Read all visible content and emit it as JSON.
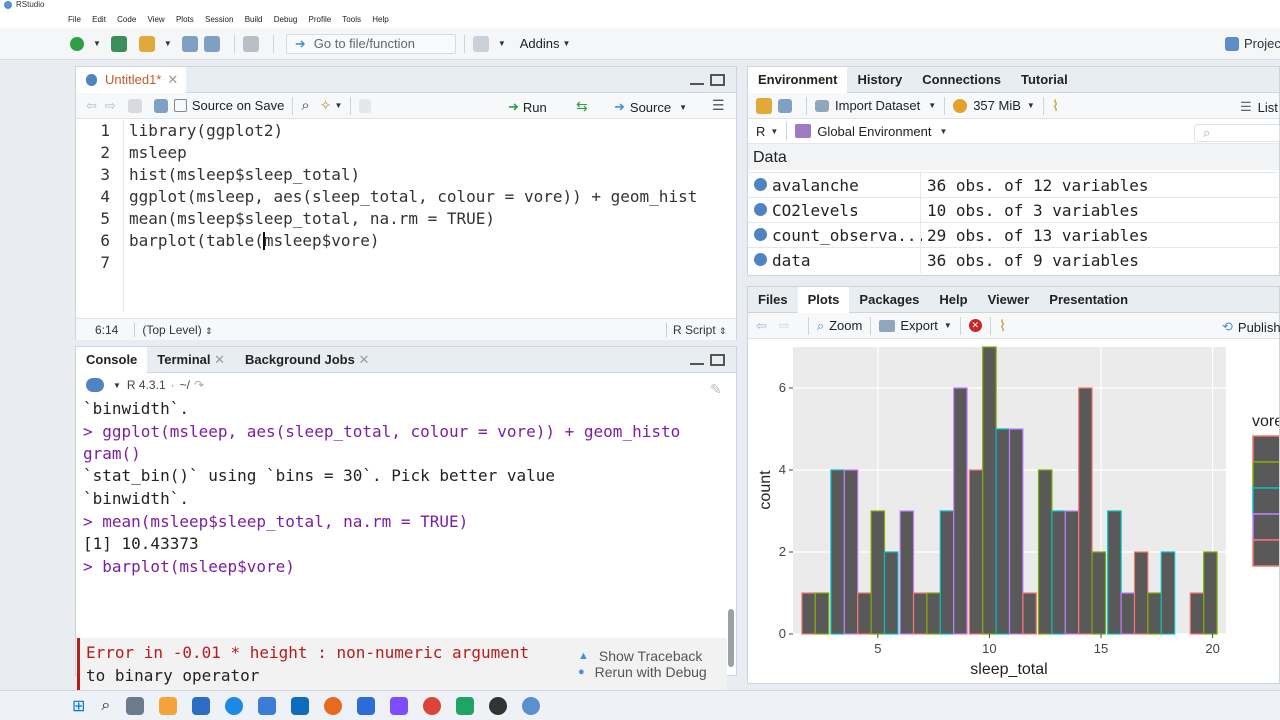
{
  "app": {
    "title": "RStudio",
    "project_label": "Project"
  },
  "menu": [
    "File",
    "Edit",
    "Code",
    "View",
    "Plots",
    "Session",
    "Build",
    "Debug",
    "Profile",
    "Tools",
    "Help"
  ],
  "toolbar": {
    "goto_placeholder": "Go to file/function",
    "addins": "Addins"
  },
  "source": {
    "tab_label": "Untitled1*",
    "source_on_save": "Source on Save",
    "run": "Run",
    "source": "Source",
    "line_numbers": [
      "1",
      "2",
      "3",
      "4",
      "5",
      "6",
      "7"
    ],
    "lines": [
      "library(ggplot2)",
      "msleep",
      "hist(msleep$sleep_total)",
      "ggplot(msleep, aes(sleep_total, colour = vore)) + geom_hist",
      "mean(msleep$sleep_total, na.rm = TRUE)",
      "barplot(table(msleep$vore)",
      ""
    ],
    "cursor_pos": "6:14",
    "scope": "(Top Level)",
    "file_type": "R Script"
  },
  "console": {
    "tabs": [
      "Console",
      "Terminal",
      "Background Jobs"
    ],
    "r_version": "R 4.3.1",
    "path": "~/",
    "lines": [
      {
        "text": "`binwidth`.",
        "cmd": false
      },
      {
        "text": "> ggplot(msleep, aes(sleep_total, colour = vore)) + geom_histo",
        "cmd": true
      },
      {
        "text": "gram()",
        "cmd": true
      },
      {
        "text": "`stat_bin()` using `bins = 30`. Pick better value",
        "cmd": false
      },
      {
        "text": "`binwidth`.",
        "cmd": false
      },
      {
        "text": "> mean(msleep$sleep_total, na.rm = TRUE)",
        "cmd": true
      },
      {
        "text": "[1] 10.43373",
        "cmd": false
      },
      {
        "text": "> barplot(msleep$vore)",
        "cmd": true
      }
    ],
    "error_line1": "Error in -0.01 * height : non-numeric argument",
    "error_line2": "to binary operator",
    "show_traceback": "Show Traceback",
    "rerun_debug": "Rerun with Debug"
  },
  "environment": {
    "tabs": [
      "Environment",
      "History",
      "Connections",
      "Tutorial"
    ],
    "import_dataset": "Import Dataset",
    "memory": "357 MiB",
    "list_label": "List",
    "lang": "R",
    "scope": "Global Environment",
    "section": "Data",
    "rows": [
      {
        "name": "avalanche",
        "value": "36 obs. of 12 variables"
      },
      {
        "name": "CO2levels",
        "value": "10 obs. of 3 variables"
      },
      {
        "name": "count_observa...",
        "value": "29 obs. of 13 variables"
      },
      {
        "name": "data",
        "value": "36 obs. of 9 variables"
      }
    ]
  },
  "plots_pane": {
    "tabs": [
      "Files",
      "Plots",
      "Packages",
      "Help",
      "Viewer",
      "Presentation"
    ],
    "zoom": "Zoom",
    "export": "Export",
    "publish": "Publish"
  },
  "colors": {
    "bar_fill": "#595959",
    "panel_bg": "#ebebeb",
    "grid": "#ffffff",
    "vore_colors": [
      "#f8766d",
      "#7cae00",
      "#00bfc4",
      "#c77cff"
    ]
  },
  "chart_data": {
    "type": "bar",
    "title": "",
    "xlabel": "sleep_total",
    "ylabel": "count",
    "legend_title": "vore",
    "legend_placement": "right",
    "xlim": [
      1.2,
      20.6
    ],
    "ylim": [
      0,
      7
    ],
    "x_ticks": [
      5,
      10,
      15,
      20
    ],
    "y_ticks": [
      0,
      2,
      4,
      6
    ],
    "grid": true,
    "bins": [
      {
        "x": 1.9,
        "count": 1
      },
      {
        "x": 2.5,
        "count": 1
      },
      {
        "x": 3.2,
        "count": 4
      },
      {
        "x": 3.8,
        "count": 4
      },
      {
        "x": 4.4,
        "count": 1
      },
      {
        "x": 5.0,
        "count": 3
      },
      {
        "x": 5.6,
        "count": 2
      },
      {
        "x": 6.3,
        "count": 3
      },
      {
        "x": 6.9,
        "count": 1
      },
      {
        "x": 7.5,
        "count": 1
      },
      {
        "x": 8.1,
        "count": 3
      },
      {
        "x": 8.7,
        "count": 6
      },
      {
        "x": 9.4,
        "count": 4
      },
      {
        "x": 10.0,
        "count": 7
      },
      {
        "x": 10.6,
        "count": 5
      },
      {
        "x": 11.2,
        "count": 5
      },
      {
        "x": 11.8,
        "count": 1
      },
      {
        "x": 12.5,
        "count": 4
      },
      {
        "x": 13.1,
        "count": 3
      },
      {
        "x": 13.7,
        "count": 3
      },
      {
        "x": 14.3,
        "count": 6
      },
      {
        "x": 14.9,
        "count": 2
      },
      {
        "x": 15.6,
        "count": 3
      },
      {
        "x": 16.2,
        "count": 1
      },
      {
        "x": 16.8,
        "count": 2
      },
      {
        "x": 17.4,
        "count": 1
      },
      {
        "x": 18.0,
        "count": 2
      },
      {
        "x": 18.6,
        "count": 0
      },
      {
        "x": 19.3,
        "count": 1
      },
      {
        "x": 19.9,
        "count": 2
      }
    ]
  }
}
